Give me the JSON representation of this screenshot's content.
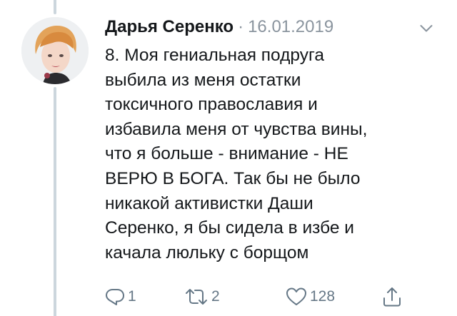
{
  "tweet": {
    "author_name": "Дарья Серенко",
    "separator": "·",
    "date": "16.01.2019",
    "text": "8. Моя гениальная подруга\nвыбила из меня остатки\nтоксичного православия и\nизбавила меня от чувства вины,\nчто я больше - внимание - НЕ\nВЕРЮ В БОГА. Так бы не было\nникакой активистки Даши\nСеренко, я бы сидела в избе и\nкачала люльку с борщом",
    "actions": {
      "reply_count": "1",
      "retweet_count": "2",
      "like_count": "128"
    }
  },
  "icons": {
    "menu": "chevron-down-icon",
    "reply": "reply-icon",
    "retweet": "retweet-icon",
    "like": "heart-icon",
    "share": "share-icon"
  },
  "colors": {
    "text": "#14171a",
    "muted": "#8a949e",
    "icon": "#657786",
    "thread_line": "#ccd6dd"
  }
}
